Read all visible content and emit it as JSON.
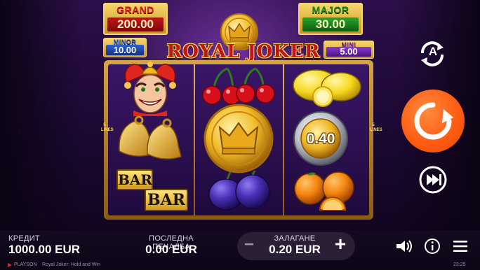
{
  "jackpots": {
    "grand": {
      "name": "GRAND",
      "value": "200.00"
    },
    "major": {
      "name": "MAJOR",
      "value": "30.00"
    },
    "minor": {
      "name": "MINOR",
      "value": "10.00"
    },
    "mini": {
      "name": "MINI",
      "value": "5.00"
    }
  },
  "logo": {
    "text": "ROYAL JOKER"
  },
  "reels": {
    "lines_left": "5 LINES",
    "lines_right": "5 LINES",
    "coin_value": "0.40",
    "bar_top": "BAR",
    "bar_bottom": "BAR",
    "symbols": {
      "reel1": [
        "joker",
        "bells",
        "bar"
      ],
      "reel2": [
        "cherries",
        "crown-coin",
        "plums"
      ],
      "reel3": [
        "lemons",
        "silver-coin",
        "oranges"
      ]
    }
  },
  "controls": {
    "autoplay_icon": "autoplay-icon",
    "autoplay_letter": "A",
    "spin_icon": "spin-icon",
    "turbo_icon": "turbo-icon"
  },
  "bottom_bar": {
    "credit_label": "КРЕДИТ",
    "credit_value": "1000.00 EUR",
    "last_win_label": "ПОСЛЕДНА ПЕЧАЛБА",
    "last_win_value": "0.00 EUR",
    "bet_label": "ЗАЛАГАНЕ",
    "bet_value": "0.20 EUR",
    "minus": "−",
    "plus": "+",
    "brand": "PLAYSON",
    "game_name": "Royal Joker: Hold and Win",
    "clock": "23:25"
  },
  "colors": {
    "spin_button": "#ff5a10",
    "frame_gold": "#d6a544",
    "background": "#2c0f4b"
  }
}
